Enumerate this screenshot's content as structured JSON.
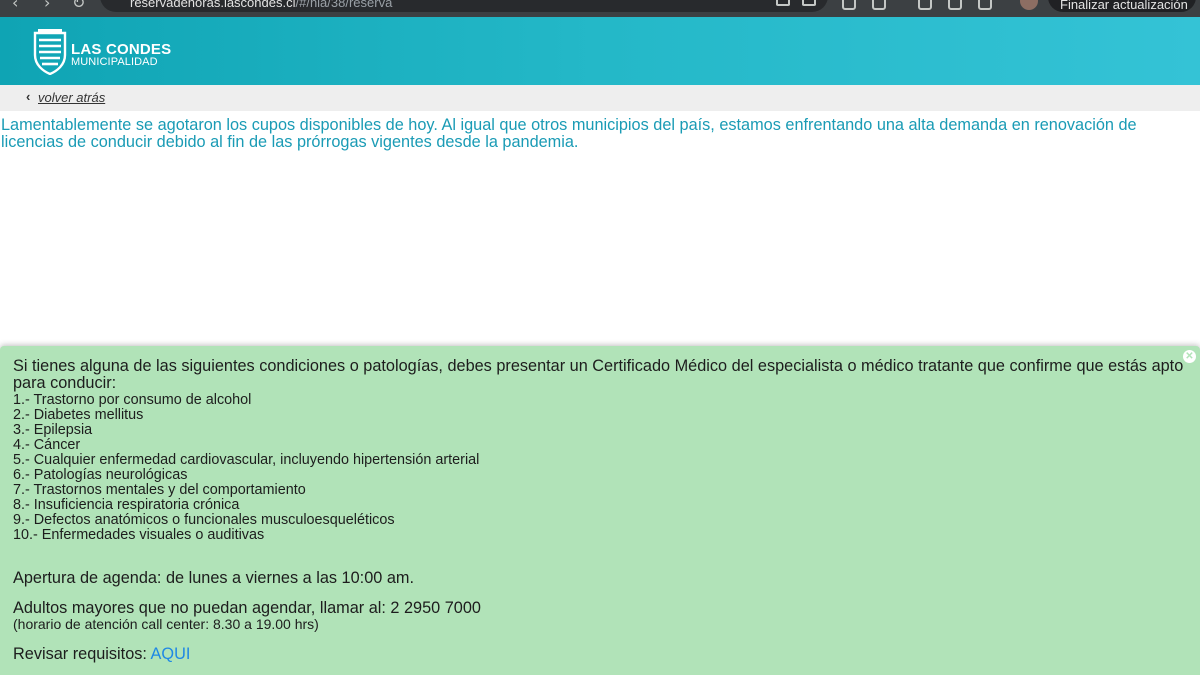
{
  "browser": {
    "url_host": "reservadehoras.lascondes.cl",
    "url_path": "/#/nla/38/reserva",
    "update_button_label": "Finalizar actualización"
  },
  "header": {
    "logo_title": "LAS CONDES",
    "logo_subtitle": "MUNICIPALIDAD",
    "brand_color": "#24b8c8"
  },
  "nav": {
    "back_link": "volver atrás"
  },
  "notice": {
    "text": "Lamentablemente se agotaron los cupos disponibles de hoy. Al igual que otros municipios del país, estamos enfrentando una alta demanda en renovación de licencias de conducir debido al fin de las prórrogas vigentes desde la pandemia.",
    "color": "#1a9bb5"
  },
  "info_panel": {
    "intro": "Si tienes alguna de las siguientes condiciones o patologías, debes presentar un Certificado Médico del especialista o médico tratante que confirme que estás apto para conducir:",
    "conditions": [
      "1.- Trastorno por consumo de alcohol",
      "2.- Diabetes mellitus",
      "3.- Epilepsia",
      "4.- Cáncer",
      "5.- Cualquier enfermedad cardiovascular, incluyendo hipertensión arterial",
      "6.- Patologías neurológicas",
      "7.- Trastornos mentales y del comportamiento",
      "8.- Insuficiencia respiratoria crónica",
      "9.- Defectos anatómicos o funcionales musculoesqueléticos",
      "10.- Enfermedades visuales o auditivas"
    ],
    "agenda_opening": "Apertura de agenda: de lunes a viernes a las 10:00 am.",
    "seniors_call": "Adultos mayores que no puedan agendar, llamar al: 2 2950 7000",
    "call_center_hours": "(horario de atención call center: 8.30 a 19.00 hrs)",
    "requirements_label": "Revisar requisitos:",
    "requirements_link": "AQUI",
    "background_color": "#b1e3b8"
  }
}
